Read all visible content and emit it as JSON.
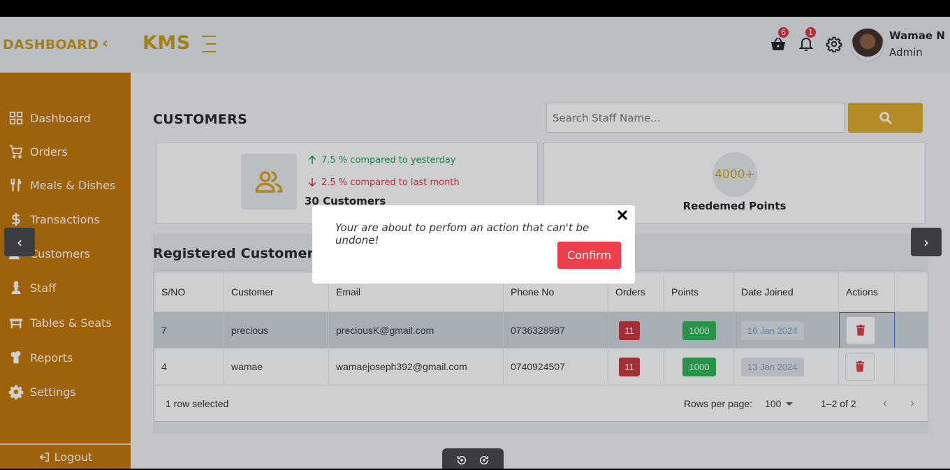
{
  "sidebar": {
    "brand": "DASHBOARD",
    "collapse_glyph": "‹",
    "items": [
      {
        "label": "Dashboard",
        "icon": "grid-icon"
      },
      {
        "label": "Orders",
        "icon": "cart-icon"
      },
      {
        "label": "Meals & Dishes",
        "icon": "utensils-icon"
      },
      {
        "label": "Transactions",
        "icon": "dollar-icon"
      },
      {
        "label": "Customers",
        "icon": "users-icon"
      },
      {
        "label": "Staff",
        "icon": "chef-icon"
      },
      {
        "label": "Tables & Seats",
        "icon": "table-icon"
      },
      {
        "label": "Reports",
        "icon": "report-icon"
      },
      {
        "label": "Settings",
        "icon": "gear-icon"
      }
    ],
    "logout_label": "Logout"
  },
  "topbar": {
    "logo": "KMS",
    "cart_count": "6",
    "notification_count": "1",
    "user_name": "Wamae N",
    "user_role": "Admin"
  },
  "page": {
    "title": "CUSTOMERS",
    "search_placeholder": "Search Staff Name..."
  },
  "stats": {
    "up_text": "7.5 % compared to yesterday",
    "down_text": "2.5 % compared to last month",
    "customers_count": "30 Customers",
    "points_value": "4000+",
    "points_label": "Reedemed Points"
  },
  "registered": {
    "title": "Registered Customers",
    "columns": [
      "S/NO",
      "Customer",
      "Email",
      "Phone No",
      "Orders",
      "Points",
      "Date Joined",
      "Actions"
    ],
    "rows": [
      {
        "sno": "7",
        "customer": "precious",
        "email": "preciousK@gmail.com",
        "phone": "0736328987",
        "orders": "11",
        "points": "1000",
        "date": "16 Jan 2024",
        "selected": true
      },
      {
        "sno": "4",
        "customer": "wamae",
        "email": "wamaejoseph392@gmail.com",
        "phone": "0740924507",
        "orders": "11",
        "points": "1000",
        "date": "13 Jan 2024",
        "selected": false
      }
    ],
    "selection_text": "1 row selected",
    "rows_per_page_label": "Rows per page:",
    "rows_per_page_value": "100",
    "range_text": "1–2 of 2"
  },
  "modal": {
    "message": "Your are about to perfom an action that can't be undone!",
    "confirm_label": "Confirm"
  },
  "viewer": {
    "prev_glyph": "‹",
    "next_glyph": "›"
  },
  "colors": {
    "sidebar": "#c27400",
    "accent": "#ddaa25",
    "danger": "#ee3f4a",
    "success": "#2eb252"
  }
}
